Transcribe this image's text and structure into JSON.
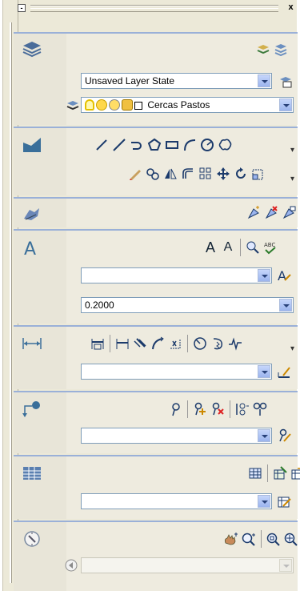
{
  "palette": {
    "title": "",
    "close_label": "x",
    "collapse_label": "-"
  },
  "layers": {
    "layer_state": "Unsaved Layer State",
    "current_layer": "Cercas Pastos"
  },
  "annotation": {
    "text_style_value": "",
    "text_height": "0.2000",
    "dim_style_value": "",
    "leader_style_value": "",
    "table_style_value": "",
    "text_size_large": "A",
    "text_size_small": "A"
  },
  "colors": {
    "panel_border": "#9ab0d8",
    "palette_bg": "#ece9d8",
    "combo_border": "#7f9db9"
  }
}
